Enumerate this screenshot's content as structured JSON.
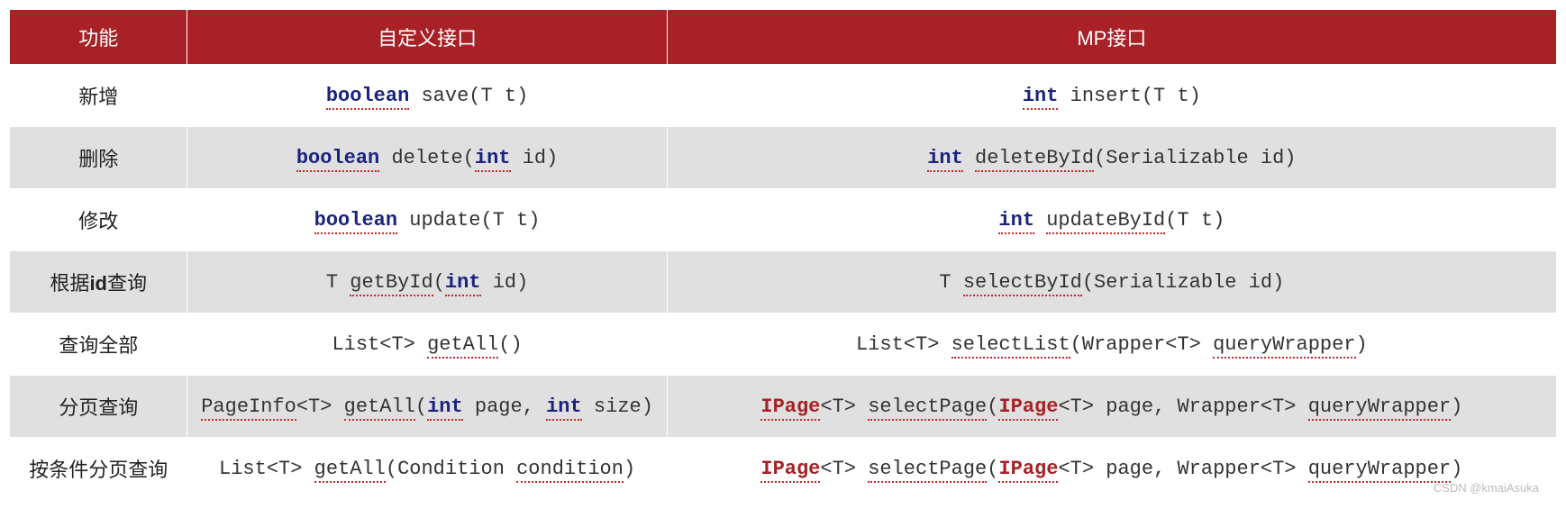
{
  "headers": {
    "function": "功能",
    "custom": "自定义接口",
    "mp": "MP接口"
  },
  "rows": [
    {
      "fn": "新增",
      "custom": {
        "ret_kw": "boolean",
        "sig": " save(T t)"
      },
      "mp": {
        "ret_kw": "int",
        "sig": " insert(T t)"
      }
    },
    {
      "fn": "删除",
      "custom": {
        "ret_kw": "boolean",
        "mid1": " delete(",
        "arg_kw": "int",
        "mid2": " id)"
      },
      "mp": {
        "ret_kw": "int",
        "mid1": " ",
        "method_sq": "deleteById",
        "mid2": "(Serializable id)"
      }
    },
    {
      "fn": "修改",
      "custom": {
        "ret_kw": "boolean",
        "sig": " update(T t)"
      },
      "mp": {
        "ret_kw": "int",
        "mid1": " ",
        "method_sq": "updateById",
        "mid2": "(T t)"
      }
    },
    {
      "fn_pre": "根据",
      "fn_b": "id",
      "fn_post": "查询",
      "custom": {
        "pre": "T ",
        "method_sq": "getById",
        "mid1": "(",
        "arg_kw": "int",
        "mid2": " id)"
      },
      "mp": {
        "pre": "T ",
        "method_sq": "selectById",
        "mid2": "(Serializable id)"
      }
    },
    {
      "fn": "查询全部",
      "custom": {
        "pre": "List<T> ",
        "method_sq": "getAll",
        "mid2": "()"
      },
      "mp": {
        "pre": "List<T> ",
        "method_sq": "selectList",
        "mid2": "(Wrapper<T> ",
        "arg_sq": "queryWrapper",
        "post": ")"
      }
    },
    {
      "fn": "分页查询",
      "custom": {
        "pre_sq": "PageInfo",
        "pre2": "<T> ",
        "method_sq": "getAll",
        "mid1": "(",
        "arg_kw": "int",
        "mid2": " page, ",
        "arg_kw2": "int",
        "mid3": " size)"
      },
      "mp": {
        "ret_err": "IPage",
        "pre2": "<T> ",
        "method_sq": "selectPage",
        "mid1": "(",
        "arg_err": "IPage",
        "mid2": "<T> page, Wrapper<T> ",
        "arg_sq": "queryWrapper",
        "post": ")"
      }
    },
    {
      "fn": "按条件分页查询",
      "custom": {
        "pre": "List<T> ",
        "method_sq": "getAll",
        "mid1": "(Condition ",
        "arg_sq": "condition",
        "post": ")"
      },
      "mp": {
        "ret_err": "IPage",
        "pre2": "<T> ",
        "method_sq": "selectPage",
        "mid1": "(",
        "arg_err": "IPage",
        "mid2": "<T> page, Wrapper<T> ",
        "arg_sq": "queryWrapper",
        "post": ")"
      }
    }
  ],
  "watermark": "CSDN @kmaiAsuka"
}
